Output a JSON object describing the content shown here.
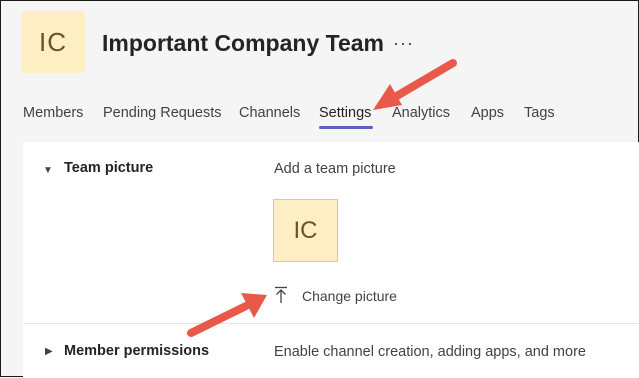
{
  "header": {
    "avatar_initials": "IC",
    "team_name": "Important Company Team",
    "more_label": "···"
  },
  "tabs": [
    {
      "label": "Members",
      "active": false
    },
    {
      "label": "Pending Requests",
      "active": false
    },
    {
      "label": "Channels",
      "active": false
    },
    {
      "label": "Settings",
      "active": true
    },
    {
      "label": "Analytics",
      "active": false
    },
    {
      "label": "Apps",
      "active": false
    },
    {
      "label": "Tags",
      "active": false
    }
  ],
  "settings": {
    "team_picture": {
      "title": "Team picture",
      "description": "Add a team picture",
      "picture_initials": "IC",
      "change_label": "Change picture",
      "expanded": true
    },
    "member_permissions": {
      "title": "Member permissions",
      "description": "Enable channel creation, adding apps, and more",
      "expanded": false
    }
  },
  "colors": {
    "accent": "#5b5fc7",
    "avatar_bg": "#fdeec3",
    "annotation_arrow": "#e8594a"
  }
}
